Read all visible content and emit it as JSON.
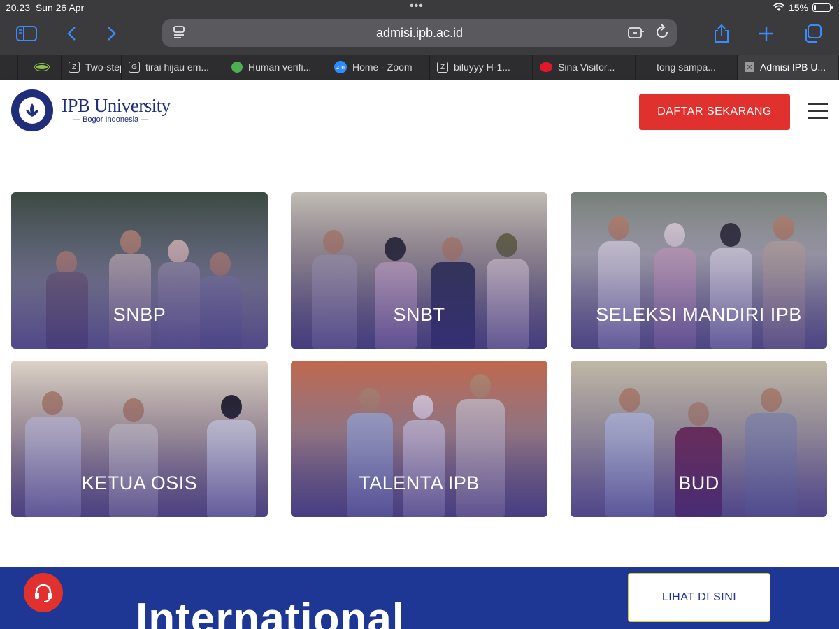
{
  "status_bar": {
    "time": "20.23",
    "date": "Sun 26 Apr",
    "battery": "15%",
    "battery_level": 0.15
  },
  "browser": {
    "url": "admisi.ipb.ac.id",
    "tabs": [
      {
        "label": "",
        "icon": "site-icon"
      },
      {
        "label": "Two-step",
        "icon": "Z"
      },
      {
        "label": "tirai hijau em...",
        "icon": "G"
      },
      {
        "label": "Human verifi...",
        "icon": "leaf-icon"
      },
      {
        "label": "Home - Zoom",
        "icon": "zm"
      },
      {
        "label": "biluyyy H-1...",
        "icon": "Z"
      },
      {
        "label": "Sina Visitor...",
        "icon": "weibo-icon"
      },
      {
        "label": "tong sampa...",
        "icon": ""
      },
      {
        "label": "Admisi IPB U...",
        "icon": "close-icon"
      }
    ]
  },
  "header": {
    "logo_name": "IPB University",
    "logo_sub": "Bogor Indonesia",
    "cta_label": "DAFTAR SEKARANG"
  },
  "cards": [
    {
      "label": "SNBP"
    },
    {
      "label": "SNBT"
    },
    {
      "label": "SELEKSI MANDIRI IPB"
    },
    {
      "label": "KETUA OSIS"
    },
    {
      "label": "TALENTA IPB"
    },
    {
      "label": "BUD"
    }
  ],
  "banner": {
    "title": "International",
    "button_label": "LIHAT DI SINI"
  },
  "colors": {
    "brand_navy": "#1f2d7a",
    "cta_red": "#e0312e",
    "banner_blue": "#1e3694"
  }
}
